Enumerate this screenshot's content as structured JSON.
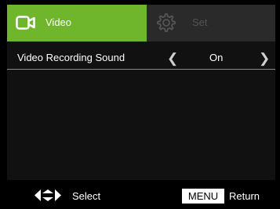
{
  "tabs": [
    {
      "label": "Video",
      "icon": "video-camera-icon",
      "active": true
    },
    {
      "label": "Set",
      "icon": "gear-icon",
      "active": false
    }
  ],
  "settings": {
    "rows": [
      {
        "label": "Video Recording Sound",
        "value": "On"
      }
    ]
  },
  "footer": {
    "select_label": "Select",
    "menu_key": "MENU",
    "return_label": "Return"
  },
  "colors": {
    "accent": "#6fb62c",
    "inactive_tab": "#2a2a2a",
    "panel": "#111111"
  }
}
